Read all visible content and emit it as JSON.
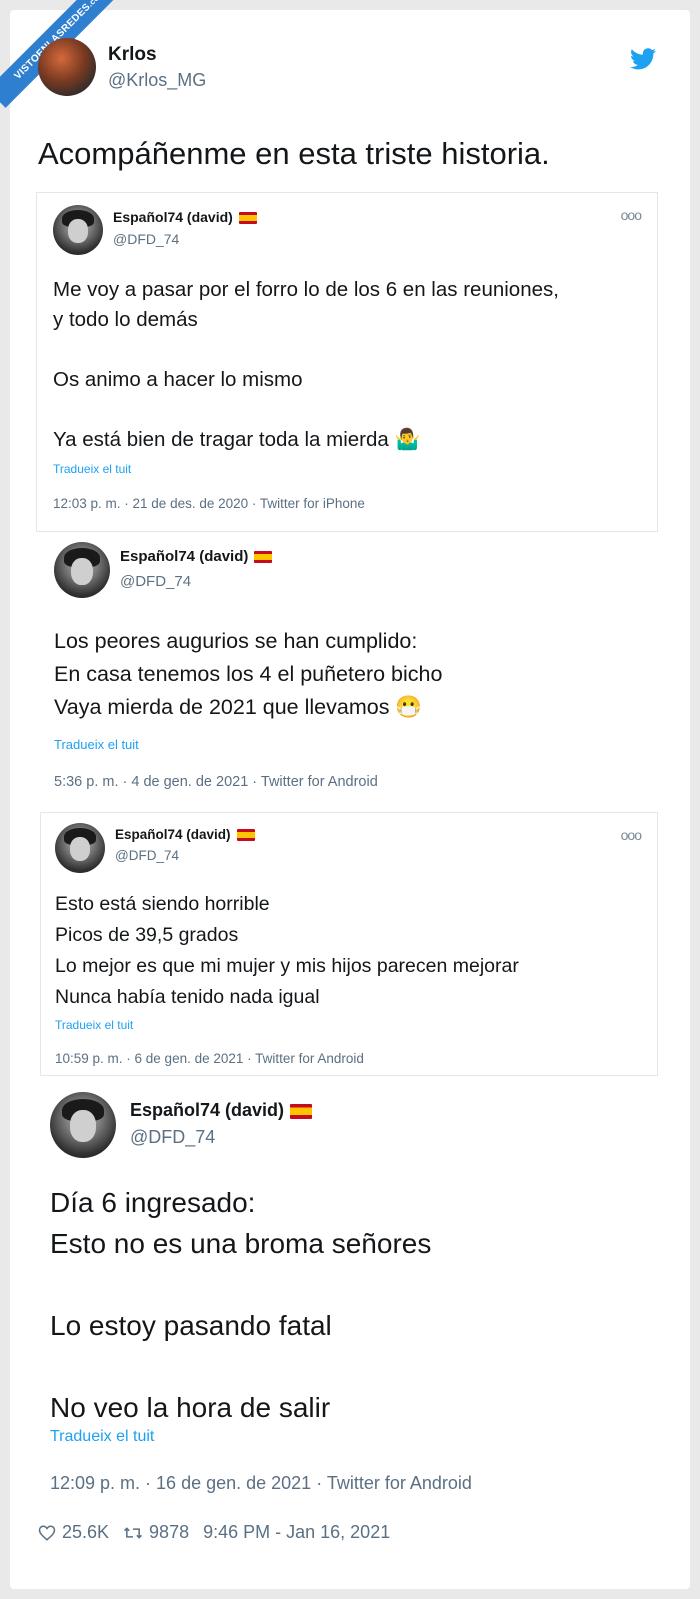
{
  "watermark": {
    "line1": "VISTOENLASREDES",
    "line2": ".com"
  },
  "author": {
    "name": "Krlos",
    "handle": "@Krlos_MG"
  },
  "tweet_text": "Acompáñenme en esta triste historia.",
  "quoted": [
    {
      "name": "Español74 (david)",
      "handle": "@DFD_74",
      "lines": [
        "Me voy a pasar por el forro lo de los 6 en las reuniones,",
        "y todo lo demás",
        "",
        "Os animo a hacer lo mismo",
        "",
        "Ya está bien de tragar toda la mierda 🤷‍♂️"
      ],
      "translate": "Tradueix el tuit",
      "meta": "12:03 p. m. · 21 de des. de 2020 · Twitter for iPhone"
    },
    {
      "name": "Español74 (david)",
      "handle": "@DFD_74",
      "lines": [
        "Los peores augurios se han cumplido:",
        "En casa tenemos los 4 el puñetero bicho",
        "Vaya mierda de 2021 que llevamos 😷"
      ],
      "translate": "Tradueix el tuit",
      "meta": "5:36 p. m. · 4 de gen. de 2021 · Twitter for Android"
    },
    {
      "name": "Español74 (david)",
      "handle": "@DFD_74",
      "lines": [
        "Esto está siendo horrible",
        "Picos de 39,5 grados",
        "Lo mejor es que mi mujer y mis hijos parecen mejorar",
        "Nunca había tenido nada igual"
      ],
      "translate": "Tradueix el tuit",
      "meta": "10:59 p. m. · 6 de gen. de 2021 · Twitter for Android"
    },
    {
      "name": "Español74 (david)",
      "handle": "@DFD_74",
      "lines": [
        "Día 6 ingresado:",
        "Esto no es una broma señores",
        "",
        "Lo estoy pasando fatal",
        "",
        "No veo la hora de salir"
      ],
      "translate": "Tradueix el tuit",
      "meta": "12:09 p. m. · 16 de gen. de 2021 · Twitter for Android"
    }
  ],
  "stats": {
    "likes": "25.6K",
    "retweets": "9878",
    "timestamp": "9:46 PM - Jan 16, 2021"
  },
  "colors": {
    "link": "#1da1f2",
    "muted": "#5b7083",
    "flag_red": "#c60b1e",
    "flag_yellow": "#ffc400"
  }
}
